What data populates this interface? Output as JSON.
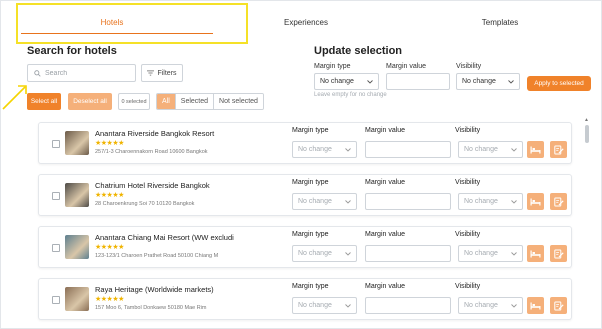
{
  "tabs": [
    {
      "label": "Hotels",
      "active": true
    },
    {
      "label": "Experiences",
      "active": false
    },
    {
      "label": "Templates",
      "active": false
    }
  ],
  "search_section": {
    "title": "Search for hotels",
    "search_placeholder": "Search",
    "filters_label": "Filters",
    "select_all_label": "Select all",
    "deselect_all_label": "Deselect all",
    "selected_count": "0 selected",
    "filter_segments": [
      {
        "label": "All",
        "active": true
      },
      {
        "label": "Selected",
        "active": false
      },
      {
        "label": "Not selected",
        "active": false
      }
    ]
  },
  "update_section": {
    "title": "Update selection",
    "margin_type_label": "Margin type",
    "margin_type_value": "No change",
    "margin_value_label": "Margin value",
    "margin_value": "",
    "visibility_label": "Visibility",
    "visibility_value": "No change",
    "apply_label": "Apply to selected",
    "hint": "Leave empty for no change"
  },
  "hotel_columns": {
    "margin_type": "Margin type",
    "margin_value": "Margin value",
    "visibility": "Visibility",
    "select_placeholder": "No change"
  },
  "hotels": [
    {
      "name": "Anantara Riverside Bangkok Resort",
      "stars": "★★★★★",
      "address": "257/1-3 Charoennakorn Road 10600 Bangkok"
    },
    {
      "name": "Chatrium Hotel Riverside Bangkok",
      "stars": "★★★★★",
      "address": "28 Charoenkrung Soi 70 10120 Bangkok"
    },
    {
      "name": "Anantara Chiang Mai Resort (WW excludi",
      "stars": "★★★★★",
      "address": "123-123/1 Charoen Prathet Road 50100 Chiang M"
    },
    {
      "name": "Raya Heritage (Worldwide markets)",
      "stars": "★★★★★",
      "address": "157 Moo 6, Tambol Donkaew 50180 Mae Rim"
    }
  ],
  "icons": {
    "search": "search-icon",
    "filters": "filter-icon",
    "bed": "bed-icon",
    "edit": "edit-document-icon",
    "chevron": "chevron-down-icon"
  },
  "colors": {
    "accent": "#f0822a",
    "accent_light": "#f5b07a",
    "highlight": "#f5e128",
    "star": "#f0b400"
  }
}
